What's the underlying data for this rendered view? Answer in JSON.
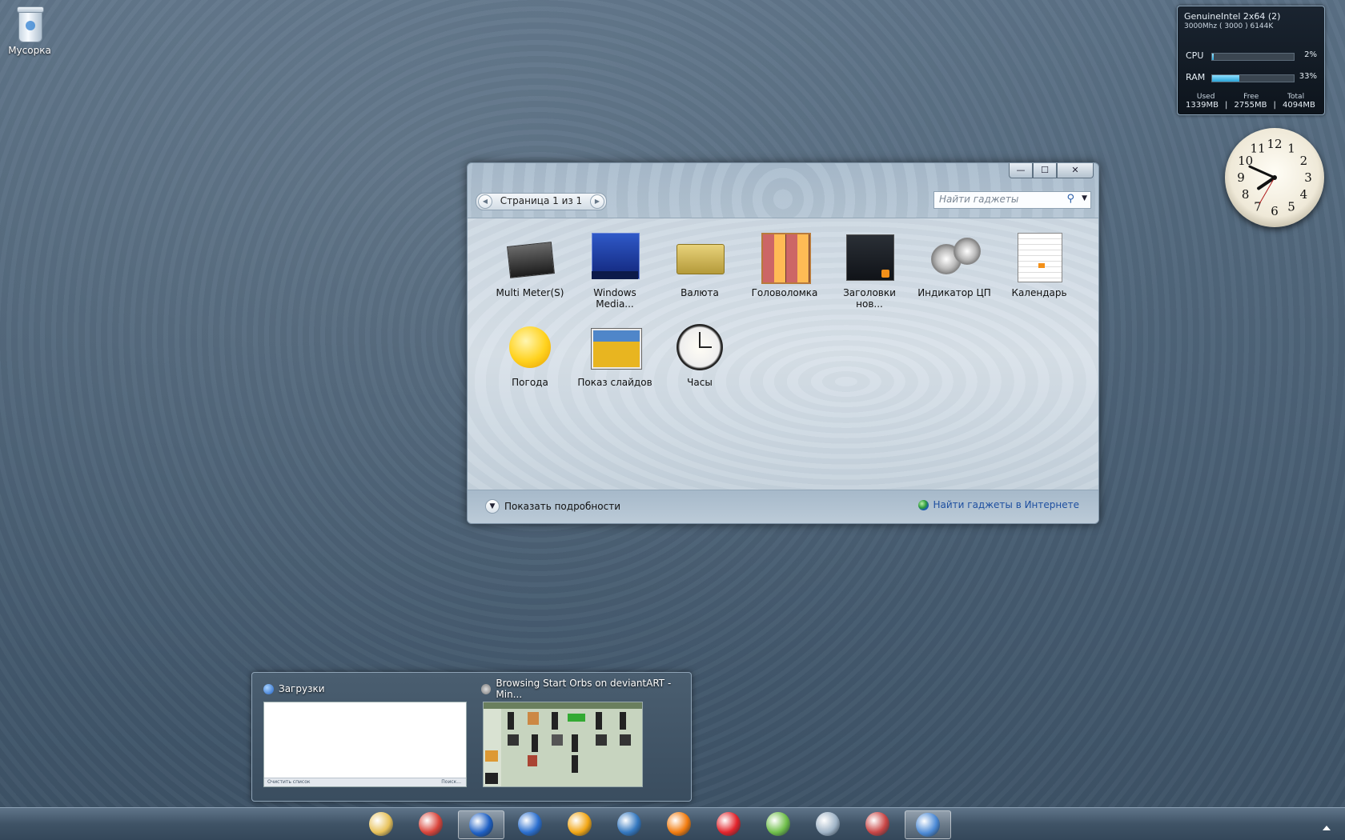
{
  "desktop": {
    "recycle_bin_label": "Мусорка"
  },
  "multimeter": {
    "cpu_name": "GenuineIntel  2x64 (2)",
    "cpu_sub": "3000Mhz ( 3000 ) 6144K",
    "cpu_label": "CPU",
    "cpu_percent": 2,
    "cpu_text": "2%",
    "ram_label": "RAM",
    "ram_percent": 33,
    "ram_text": "33%",
    "mem_headers": [
      "Used",
      "Free",
      "Total"
    ],
    "mem_values": [
      "1339MB",
      "|",
      "2755MB",
      "|",
      "4094MB"
    ]
  },
  "clock": {
    "numbers": [
      "12",
      "1",
      "2",
      "3",
      "4",
      "5",
      "6",
      "7",
      "8",
      "9",
      "10",
      "11"
    ]
  },
  "gadgets_window": {
    "pager_text": "Страница 1 из 1",
    "search_placeholder": "Найти гаджеты",
    "min_glyph": "—",
    "max_glyph": "☐",
    "close_glyph": "✕",
    "gadgets": [
      {
        "label": "Multi Meter(S)",
        "icon": "multimeter-icon"
      },
      {
        "label": "Windows Media...",
        "icon": "windows-media-center-icon"
      },
      {
        "label": "Валюта",
        "icon": "currency-icon"
      },
      {
        "label": "Головоломка",
        "icon": "puzzle-icon"
      },
      {
        "label": "Заголовки нов...",
        "icon": "news-headlines-icon"
      },
      {
        "label": "Индикатор ЦП",
        "icon": "cpu-meter-icon"
      },
      {
        "label": "Календарь",
        "icon": "calendar-icon"
      },
      {
        "label": "Погода",
        "icon": "weather-sun-icon"
      },
      {
        "label": "Показ слайдов",
        "icon": "slideshow-icon"
      },
      {
        "label": "Часы",
        "icon": "clock-icon"
      }
    ],
    "show_details": "Показать подробности",
    "online_link": "Найти гаджеты в Интернете"
  },
  "preview": {
    "window1_title": "Загрузки",
    "window1_footer_left": "Очистить список",
    "window1_footer_right": "Поиск...",
    "window2_title": "Browsing Start Orbs on deviantART - Min..."
  },
  "taskbar": {
    "items": [
      {
        "name": "explorer",
        "icon": "folder-icon",
        "color": "#e8c25a"
      },
      {
        "name": "chrome",
        "icon": "chrome-icon",
        "color": "#d9443a"
      },
      {
        "name": "downloads",
        "icon": "downloads-globe-icon",
        "color": "#1d5fc4",
        "active": true
      },
      {
        "name": "app-yu",
        "icon": "yu-icon",
        "color": "#2b6fcf"
      },
      {
        "name": "aimp",
        "icon": "aimp-icon",
        "color": "#f2a614"
      },
      {
        "name": "kmplayer",
        "icon": "kmplayer-icon",
        "color": "#3478c0"
      },
      {
        "name": "vlc",
        "icon": "vlc-cone-icon",
        "color": "#f27c0f"
      },
      {
        "name": "mailru",
        "icon": "m-icon",
        "color": "#e3242b"
      },
      {
        "name": "app-tools",
        "icon": "tools-icon",
        "color": "#6fbf4a"
      },
      {
        "name": "computer",
        "icon": "computer-icon",
        "color": "#9fb3c6"
      },
      {
        "name": "star-app",
        "icon": "star-icon",
        "color": "#c94545"
      },
      {
        "name": "gadgets",
        "icon": "gadgets-desktop-icon",
        "color": "#4c8ad6",
        "active": true
      }
    ]
  }
}
